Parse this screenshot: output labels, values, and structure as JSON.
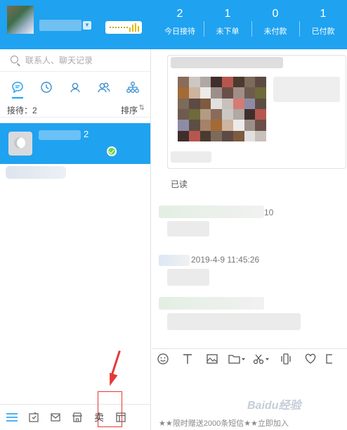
{
  "header": {
    "stats": [
      {
        "value": "2",
        "label": "今日接待"
      },
      {
        "value": "1",
        "label": "未下单"
      },
      {
        "value": "0",
        "label": "未付款"
      },
      {
        "value": "1",
        "label": "已付款"
      }
    ]
  },
  "search": {
    "placeholder": "联系人、聊天记录"
  },
  "tabs": [
    "chat-icon",
    "history-icon",
    "contact-icon",
    "group-icon",
    "org-icon"
  ],
  "list": {
    "count_label": "接待：2",
    "sort_label": "排序",
    "sort_icon": "⇅"
  },
  "chat_item": {
    "badge": "2"
  },
  "bottom_bar": {
    "sell_label": "卖"
  },
  "messages": {
    "read_label": "已读",
    "time_fragment_1": "10",
    "time_fragment_2": "2019-4-9 11:45:26"
  },
  "composer": {
    "promo": "★★限时赠送2000条短信★★立即加入"
  },
  "watermark": "Baidu经验",
  "colors": {
    "brand": "#1fa2f0",
    "annotation": "#e53935",
    "online": "#6bd54f"
  }
}
